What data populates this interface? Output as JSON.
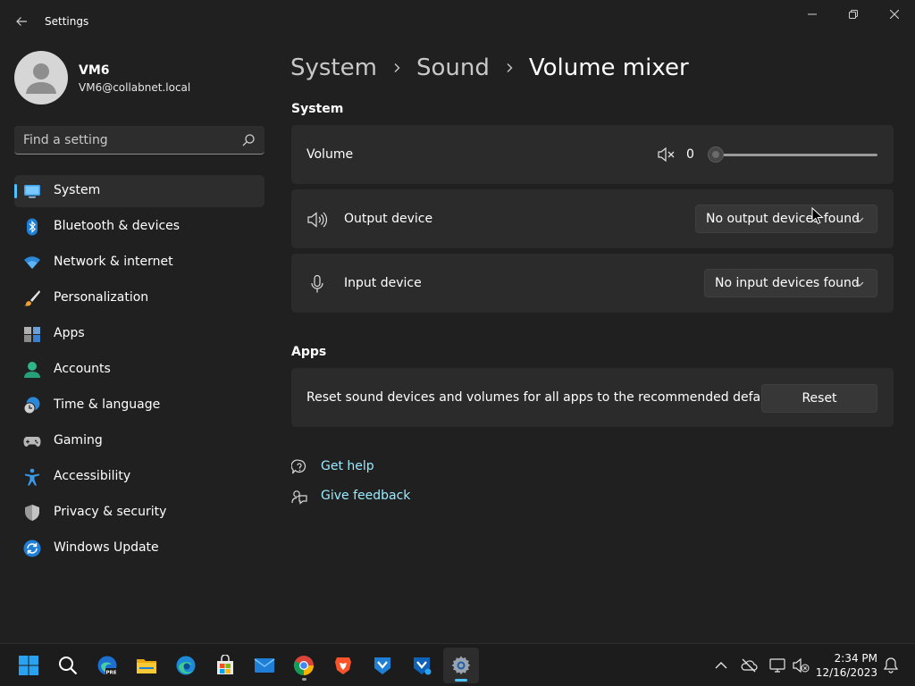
{
  "window": {
    "title": "Settings",
    "back_label": "Back",
    "minimize_label": "Minimize",
    "maximize_label": "Maximize",
    "close_label": "Close"
  },
  "profile": {
    "name": "VM6",
    "email": "VM6@collabnet.local"
  },
  "search": {
    "placeholder": "Find a setting"
  },
  "sidebar": {
    "items": [
      {
        "label": "System",
        "icon": "system-icon",
        "selected": true
      },
      {
        "label": "Bluetooth & devices",
        "icon": "bluetooth-icon"
      },
      {
        "label": "Network & internet",
        "icon": "wifi-icon"
      },
      {
        "label": "Personalization",
        "icon": "brush-icon"
      },
      {
        "label": "Apps",
        "icon": "apps-icon"
      },
      {
        "label": "Accounts",
        "icon": "accounts-icon"
      },
      {
        "label": "Time & language",
        "icon": "time-language-icon"
      },
      {
        "label": "Gaming",
        "icon": "gaming-icon"
      },
      {
        "label": "Accessibility",
        "icon": "accessibility-icon"
      },
      {
        "label": "Privacy & security",
        "icon": "shield-icon"
      },
      {
        "label": "Windows Update",
        "icon": "windows-update-icon"
      }
    ],
    "accent_color": "#4cc2ff"
  },
  "breadcrumb": [
    "System",
    "Sound",
    "Volume mixer"
  ],
  "system_section": {
    "title": "System",
    "volume": {
      "label": "Volume",
      "value": "0",
      "level_percent": 0,
      "icon": "mute-icon"
    },
    "output_device": {
      "label": "Output device",
      "selected": "No output devices found",
      "icon": "speaker-icon"
    },
    "input_device": {
      "label": "Input device",
      "selected": "No input devices found",
      "icon": "microphone-icon"
    }
  },
  "apps_section": {
    "title": "Apps",
    "reset_text": "Reset sound devices and volumes for all apps to the recommended defaults",
    "reset_button": "Reset"
  },
  "links": {
    "get_help": "Get help",
    "give_feedback": "Give feedback",
    "link_color": "#99ebff"
  },
  "taskbar": {
    "apps": [
      "start-icon",
      "search-icon",
      "edge-beta-icon",
      "file-explorer-icon",
      "edge-icon",
      "store-icon",
      "mail-icon",
      "chrome-icon",
      "brave-icon",
      "vmware-icon",
      "vmware-alt-icon",
      "settings-icon"
    ],
    "clock_time": "2:34 PM",
    "clock_date": "12/16/2023"
  }
}
